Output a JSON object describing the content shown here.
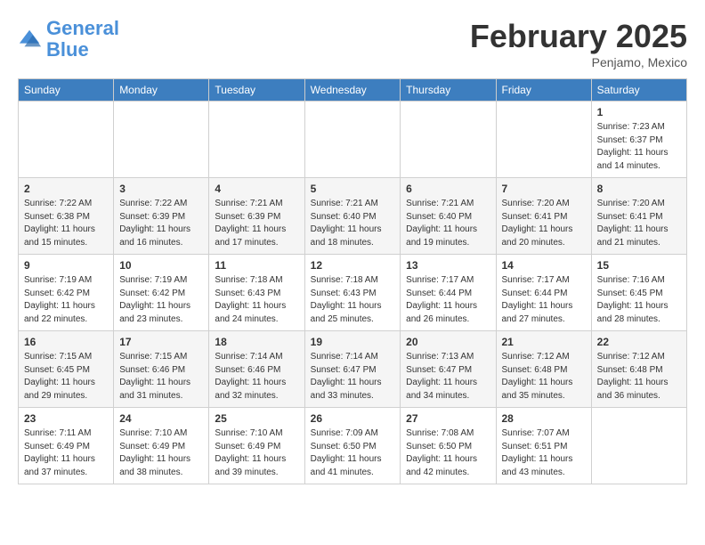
{
  "header": {
    "logo_line1": "General",
    "logo_line2": "Blue",
    "month": "February 2025",
    "location": "Penjamo, Mexico"
  },
  "weekdays": [
    "Sunday",
    "Monday",
    "Tuesday",
    "Wednesday",
    "Thursday",
    "Friday",
    "Saturday"
  ],
  "weeks": [
    [
      {
        "day": "",
        "sunrise": "",
        "sunset": "",
        "daylight": ""
      },
      {
        "day": "",
        "sunrise": "",
        "sunset": "",
        "daylight": ""
      },
      {
        "day": "",
        "sunrise": "",
        "sunset": "",
        "daylight": ""
      },
      {
        "day": "",
        "sunrise": "",
        "sunset": "",
        "daylight": ""
      },
      {
        "day": "",
        "sunrise": "",
        "sunset": "",
        "daylight": ""
      },
      {
        "day": "",
        "sunrise": "",
        "sunset": "",
        "daylight": ""
      },
      {
        "day": "1",
        "sunrise": "7:23 AM",
        "sunset": "6:37 PM",
        "daylight": "11 hours and 14 minutes."
      }
    ],
    [
      {
        "day": "2",
        "sunrise": "7:22 AM",
        "sunset": "6:38 PM",
        "daylight": "11 hours and 15 minutes."
      },
      {
        "day": "3",
        "sunrise": "7:22 AM",
        "sunset": "6:39 PM",
        "daylight": "11 hours and 16 minutes."
      },
      {
        "day": "4",
        "sunrise": "7:21 AM",
        "sunset": "6:39 PM",
        "daylight": "11 hours and 17 minutes."
      },
      {
        "day": "5",
        "sunrise": "7:21 AM",
        "sunset": "6:40 PM",
        "daylight": "11 hours and 18 minutes."
      },
      {
        "day": "6",
        "sunrise": "7:21 AM",
        "sunset": "6:40 PM",
        "daylight": "11 hours and 19 minutes."
      },
      {
        "day": "7",
        "sunrise": "7:20 AM",
        "sunset": "6:41 PM",
        "daylight": "11 hours and 20 minutes."
      },
      {
        "day": "8",
        "sunrise": "7:20 AM",
        "sunset": "6:41 PM",
        "daylight": "11 hours and 21 minutes."
      }
    ],
    [
      {
        "day": "9",
        "sunrise": "7:19 AM",
        "sunset": "6:42 PM",
        "daylight": "11 hours and 22 minutes."
      },
      {
        "day": "10",
        "sunrise": "7:19 AM",
        "sunset": "6:42 PM",
        "daylight": "11 hours and 23 minutes."
      },
      {
        "day": "11",
        "sunrise": "7:18 AM",
        "sunset": "6:43 PM",
        "daylight": "11 hours and 24 minutes."
      },
      {
        "day": "12",
        "sunrise": "7:18 AM",
        "sunset": "6:43 PM",
        "daylight": "11 hours and 25 minutes."
      },
      {
        "day": "13",
        "sunrise": "7:17 AM",
        "sunset": "6:44 PM",
        "daylight": "11 hours and 26 minutes."
      },
      {
        "day": "14",
        "sunrise": "7:17 AM",
        "sunset": "6:44 PM",
        "daylight": "11 hours and 27 minutes."
      },
      {
        "day": "15",
        "sunrise": "7:16 AM",
        "sunset": "6:45 PM",
        "daylight": "11 hours and 28 minutes."
      }
    ],
    [
      {
        "day": "16",
        "sunrise": "7:15 AM",
        "sunset": "6:45 PM",
        "daylight": "11 hours and 29 minutes."
      },
      {
        "day": "17",
        "sunrise": "7:15 AM",
        "sunset": "6:46 PM",
        "daylight": "11 hours and 31 minutes."
      },
      {
        "day": "18",
        "sunrise": "7:14 AM",
        "sunset": "6:46 PM",
        "daylight": "11 hours and 32 minutes."
      },
      {
        "day": "19",
        "sunrise": "7:14 AM",
        "sunset": "6:47 PM",
        "daylight": "11 hours and 33 minutes."
      },
      {
        "day": "20",
        "sunrise": "7:13 AM",
        "sunset": "6:47 PM",
        "daylight": "11 hours and 34 minutes."
      },
      {
        "day": "21",
        "sunrise": "7:12 AM",
        "sunset": "6:48 PM",
        "daylight": "11 hours and 35 minutes."
      },
      {
        "day": "22",
        "sunrise": "7:12 AM",
        "sunset": "6:48 PM",
        "daylight": "11 hours and 36 minutes."
      }
    ],
    [
      {
        "day": "23",
        "sunrise": "7:11 AM",
        "sunset": "6:49 PM",
        "daylight": "11 hours and 37 minutes."
      },
      {
        "day": "24",
        "sunrise": "7:10 AM",
        "sunset": "6:49 PM",
        "daylight": "11 hours and 38 minutes."
      },
      {
        "day": "25",
        "sunrise": "7:10 AM",
        "sunset": "6:49 PM",
        "daylight": "11 hours and 39 minutes."
      },
      {
        "day": "26",
        "sunrise": "7:09 AM",
        "sunset": "6:50 PM",
        "daylight": "11 hours and 41 minutes."
      },
      {
        "day": "27",
        "sunrise": "7:08 AM",
        "sunset": "6:50 PM",
        "daylight": "11 hours and 42 minutes."
      },
      {
        "day": "28",
        "sunrise": "7:07 AM",
        "sunset": "6:51 PM",
        "daylight": "11 hours and 43 minutes."
      },
      {
        "day": "",
        "sunrise": "",
        "sunset": "",
        "daylight": ""
      }
    ]
  ]
}
